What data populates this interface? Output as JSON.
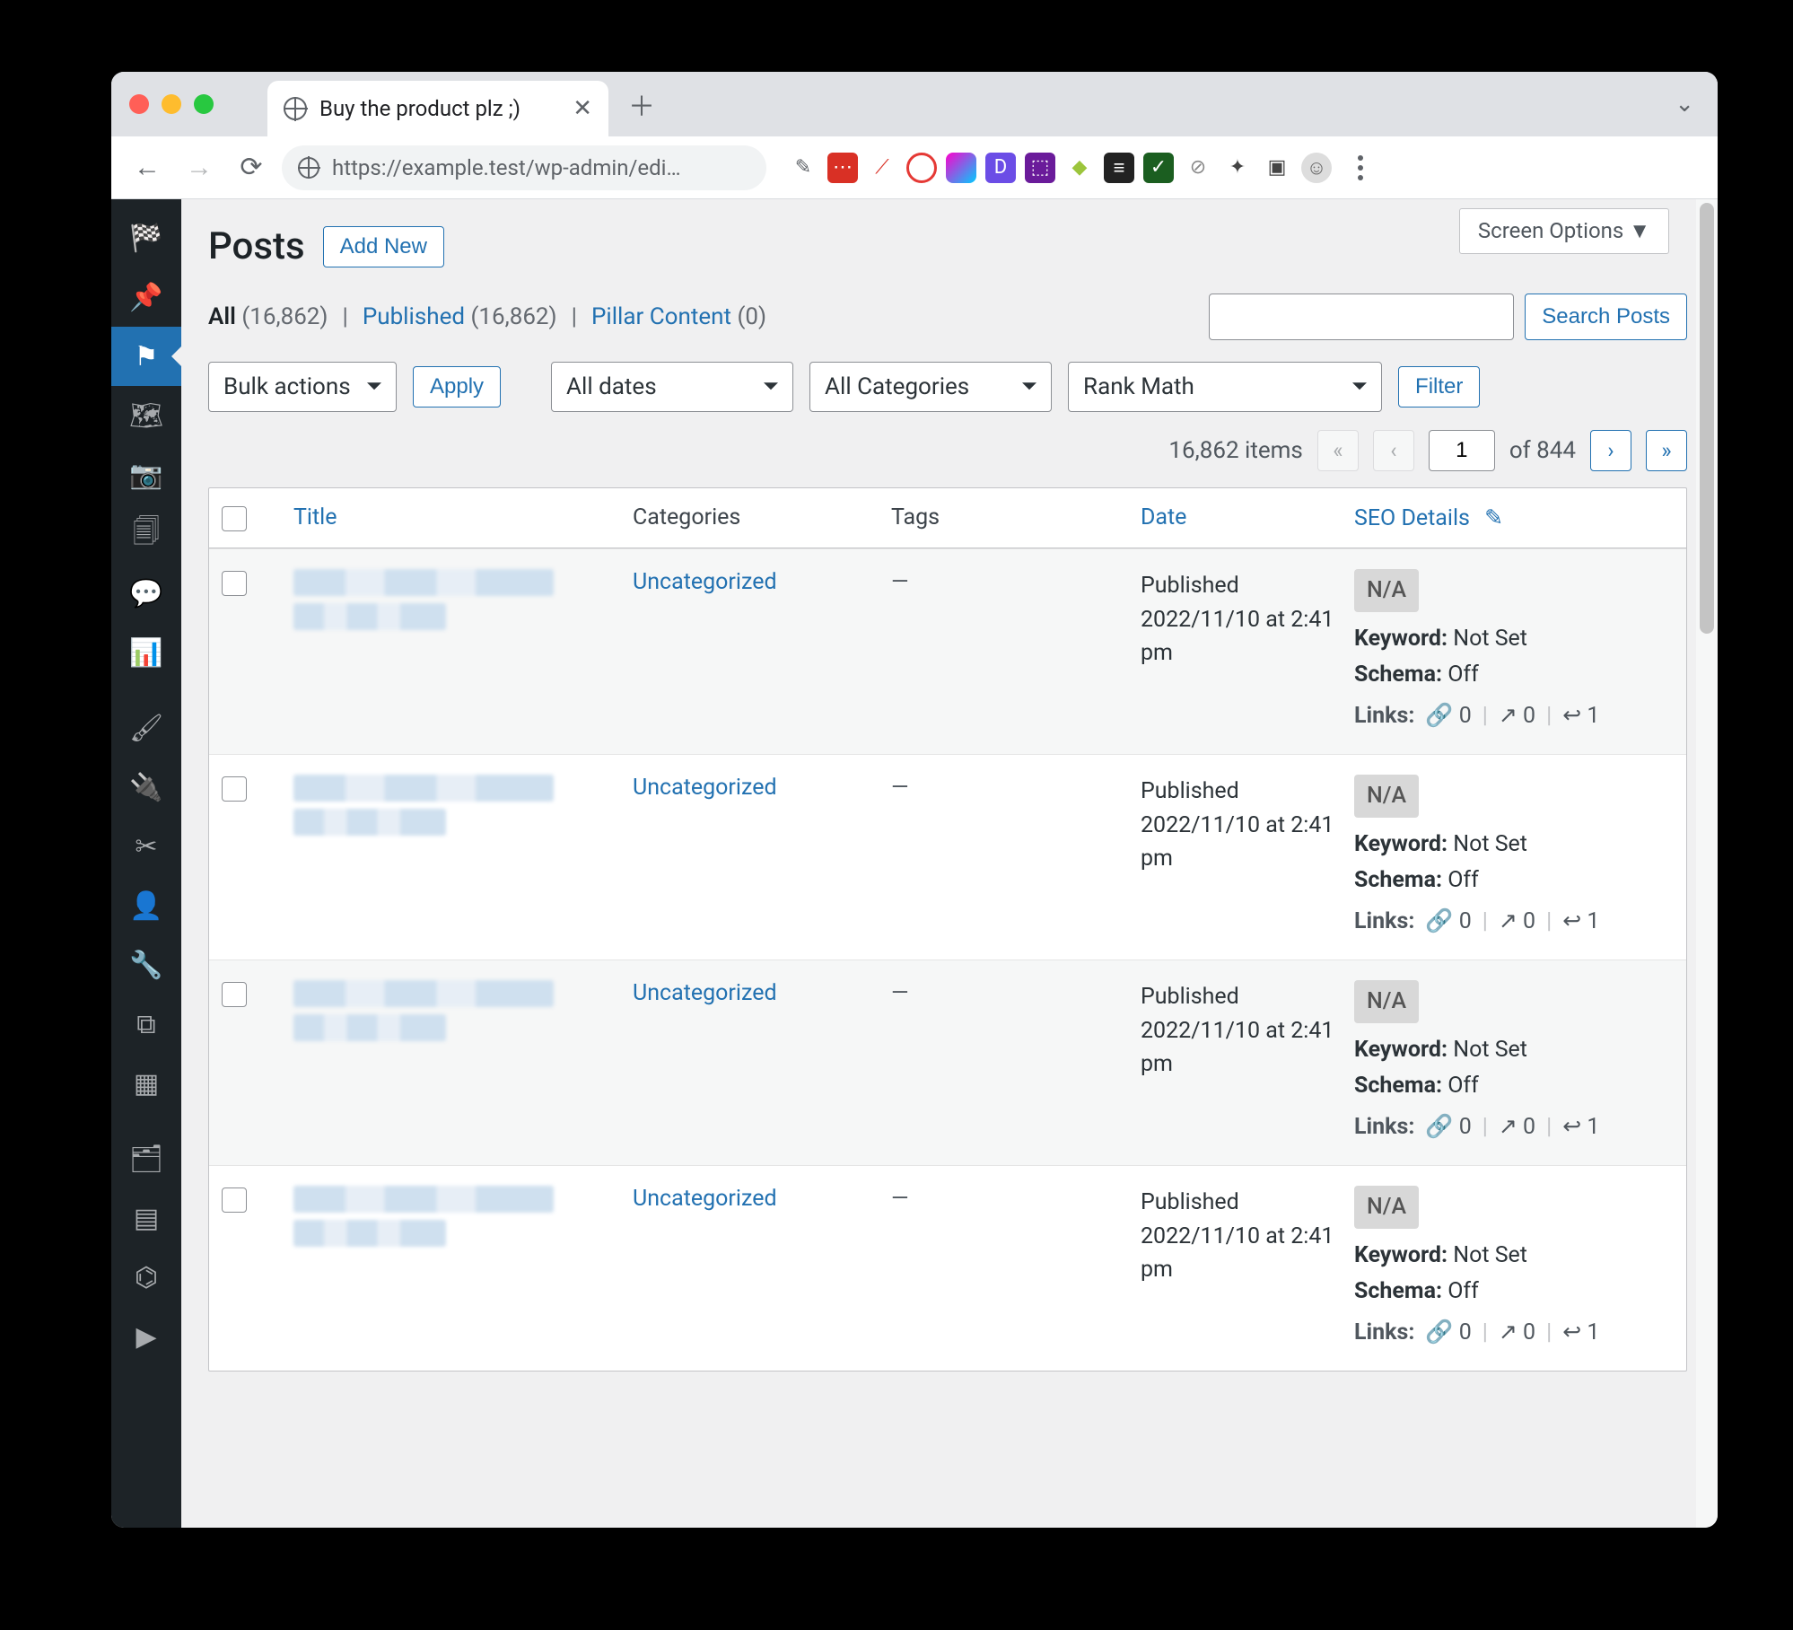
{
  "browser": {
    "tab_title": "Buy the product plz ;)",
    "url": "https://example.test/wp-admin/edi…"
  },
  "screen_options": "Screen Options  ▼",
  "heading": "Posts",
  "add_new": "Add New",
  "views": {
    "all_label": "All",
    "all_count": "(16,862)",
    "published_label": "Published",
    "published_count": "(16,862)",
    "pillar_label": "Pillar Content",
    "pillar_count": "(0)"
  },
  "search": {
    "button": "Search Posts"
  },
  "bulk": {
    "select": "Bulk actions",
    "apply": "Apply"
  },
  "filters": {
    "dates": "All dates",
    "cats": "All Categories",
    "rank": "Rank Math",
    "filter": "Filter"
  },
  "pager": {
    "items": "16,862 items",
    "current": "1",
    "of": "of 844"
  },
  "cols": {
    "title": "Title",
    "categories": "Categories",
    "tags": "Tags",
    "date": "Date",
    "seo": "SEO Details"
  },
  "rows": [
    {
      "category": "Uncategorized",
      "tags": "—",
      "date_status": "Published",
      "date_value": "2022/11/10 at 2:41 pm",
      "na": "N/A",
      "kw_label": "Keyword:",
      "kw_value": "Not Set",
      "sc_label": "Schema:",
      "sc_value": "Off",
      "links_label": "Links:",
      "l_int": "0",
      "l_ext": "0",
      "l_in": "1"
    },
    {
      "category": "Uncategorized",
      "tags": "—",
      "date_status": "Published",
      "date_value": "2022/11/10 at 2:41 pm",
      "na": "N/A",
      "kw_label": "Keyword:",
      "kw_value": "Not Set",
      "sc_label": "Schema:",
      "sc_value": "Off",
      "links_label": "Links:",
      "l_int": "0",
      "l_ext": "0",
      "l_in": "1"
    },
    {
      "category": "Uncategorized",
      "tags": "—",
      "date_status": "Published",
      "date_value": "2022/11/10 at 2:41 pm",
      "na": "N/A",
      "kw_label": "Keyword:",
      "kw_value": "Not Set",
      "sc_label": "Schema:",
      "sc_value": "Off",
      "links_label": "Links:",
      "l_int": "0",
      "l_ext": "0",
      "l_in": "1"
    },
    {
      "category": "Uncategorized",
      "tags": "—",
      "date_status": "Published",
      "date_value": "2022/11/10 at 2:41 pm",
      "na": "N/A",
      "kw_label": "Keyword:",
      "kw_value": "Not Set",
      "sc_label": "Schema:",
      "sc_value": "Off",
      "links_label": "Links:",
      "l_int": "0",
      "l_ext": "0",
      "l_in": "1"
    }
  ]
}
